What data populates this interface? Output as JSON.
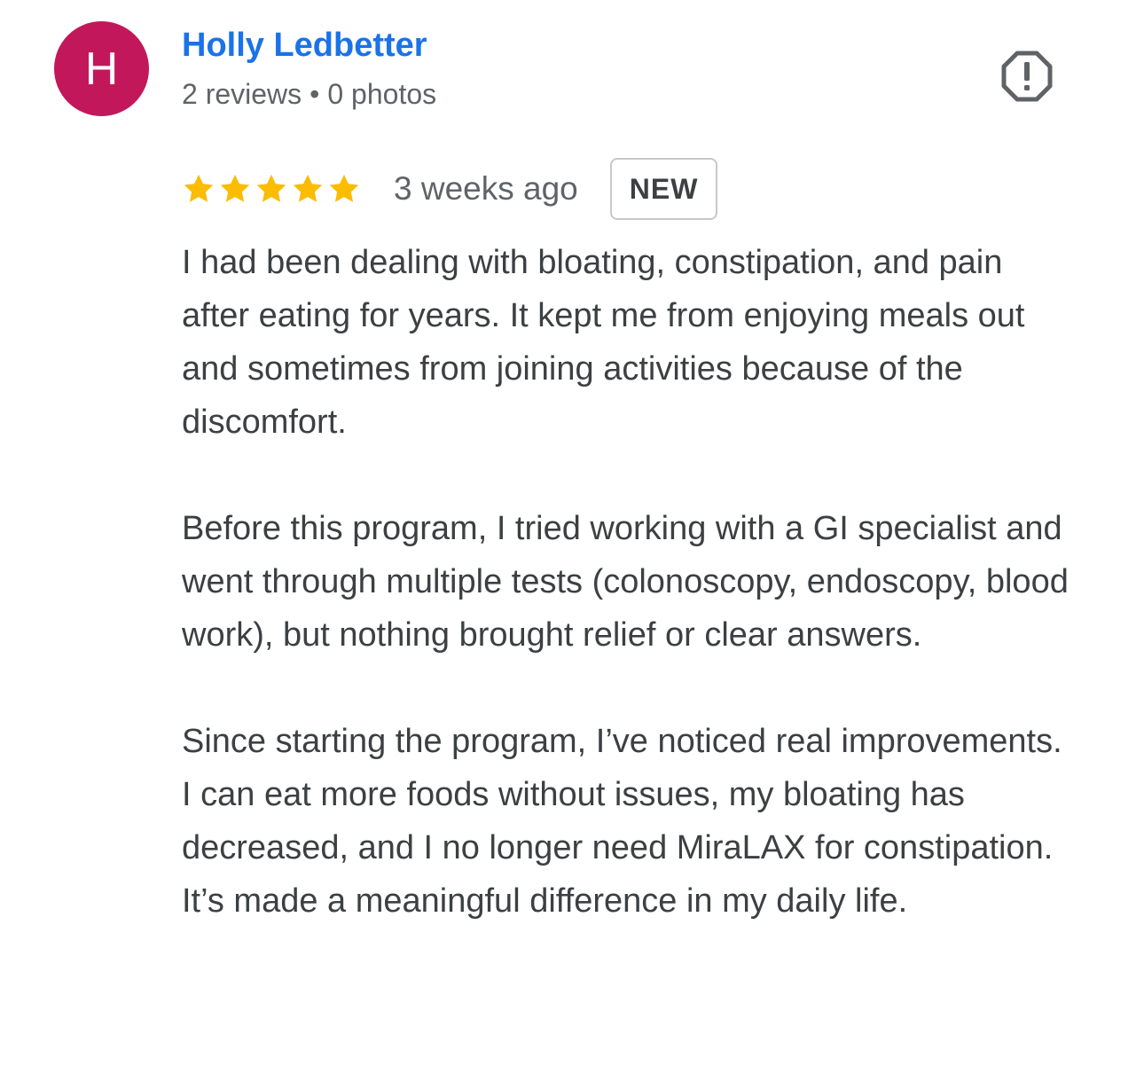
{
  "reviewer": {
    "initial": "H",
    "avatar_color": "#c2185b",
    "name": "Holly Ledbetter",
    "reviews": "2 reviews",
    "separator": "•",
    "photos": "0 photos"
  },
  "actions": {
    "report_icon": "report-flag-icon"
  },
  "review": {
    "rating": 5,
    "rating_max": 5,
    "star_color": "#fbbc04",
    "time_ago": "3 weeks ago",
    "badge": "NEW",
    "paragraphs": [
      "I had been dealing with bloating, constipation, and pain after eating for years. It kept me from enjoying meals out and sometimes from joining activities because of the discomfort.",
      "Before this program, I tried working with a GI specialist and went through multiple tests (colonoscopy, endoscopy, blood work), but nothing brought relief or clear answers.",
      "Since starting the program, I’ve noticed real improvements. I can eat more foods without issues, my bloating has decreased, and I no longer need MiraLAX for constipation. It’s made a meaningful difference in my daily life."
    ]
  },
  "colors": {
    "name_link": "#1a73e8",
    "secondary_text": "#5f6368",
    "body_text": "#3c4043"
  }
}
